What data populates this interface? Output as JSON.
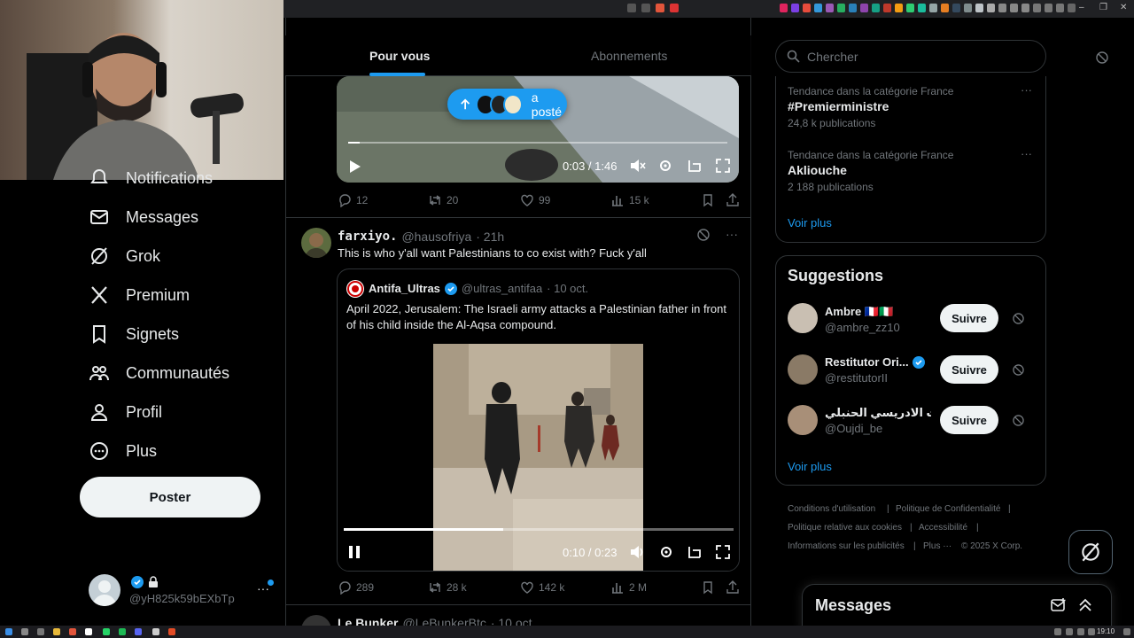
{
  "tabs": {
    "for_you": "Pour vous",
    "following": "Abonnements"
  },
  "repost_pill": {
    "label": "a posté"
  },
  "video1": {
    "time": "0:03 / 1:46",
    "progress": 0.03
  },
  "post1_actions": {
    "replies": "12",
    "reposts": "20",
    "likes": "99",
    "views": "15 k"
  },
  "post2": {
    "display_name": "farxiyo.",
    "handle": "@hausofriya",
    "time": "· 21h",
    "text": "This is who y'all want Palestinians to co exist with? Fuck y'all",
    "quote": {
      "name": "Antifa_Ultras",
      "handle": "@ultras_antifaa",
      "date": "· 10 oct.",
      "text": "April 2022, Jerusalem: The Israeli army attacks a Palestinian father in front of his child inside the Al-Aqsa compound.",
      "video_time": "0:10 / 0:23",
      "video_progress": 0.41
    },
    "actions": {
      "replies": "289",
      "reposts": "28 k",
      "likes": "142 k",
      "views": "2 M"
    }
  },
  "post3": {
    "display_name": "Le Bunker",
    "handle": "@LeBunkerBtc",
    "date": "· 10 oct."
  },
  "nav": {
    "notifications": "Notifications",
    "messages": "Messages",
    "grok": "Grok",
    "premium": "Premium",
    "bookmarks": "Signets",
    "communities": "Communautés",
    "profile": "Profil",
    "more": "Plus",
    "post_button": "Poster"
  },
  "account": {
    "handle": "@yH825k59bEXbTp"
  },
  "search": {
    "placeholder": "Chercher"
  },
  "trends": [
    {
      "context": "Tendance dans la catégorie France",
      "name": "#Premierministre",
      "count": "24,8 k publications"
    },
    {
      "context": "Tendance dans la catégorie France",
      "name": "Akliouche",
      "count": "2 188 publications"
    }
  ],
  "trends_more": "Voir plus",
  "suggestions": {
    "title": "Suggestions",
    "follow_label": "Suivre",
    "more": "Voir plus",
    "users": [
      {
        "name": "Ambre 🇫🇷🇮🇹",
        "handle": "@ambre_zz10"
      },
      {
        "name": "Restitutor Ori...",
        "handle": "@restitutorII"
      },
      {
        "name": "ث الادريسي الحنبلي",
        "handle": "@Oujdi_be"
      }
    ]
  },
  "footer": {
    "terms": "Conditions d'utilisation",
    "privacy": "Politique de Confidentialité",
    "cookies": "Politique relative aux cookies",
    "accessibility": "Accessibilité",
    "ads": "Informations sur les publicités",
    "more": "Plus ···",
    "copyright": "© 2025 X Corp."
  },
  "messages_drawer": {
    "title": "Messages"
  },
  "clock": "19:10",
  "colors": {
    "accent": "#1d9bf0",
    "background": "#000000",
    "border": "#2f3336",
    "muted": "#71767b"
  }
}
